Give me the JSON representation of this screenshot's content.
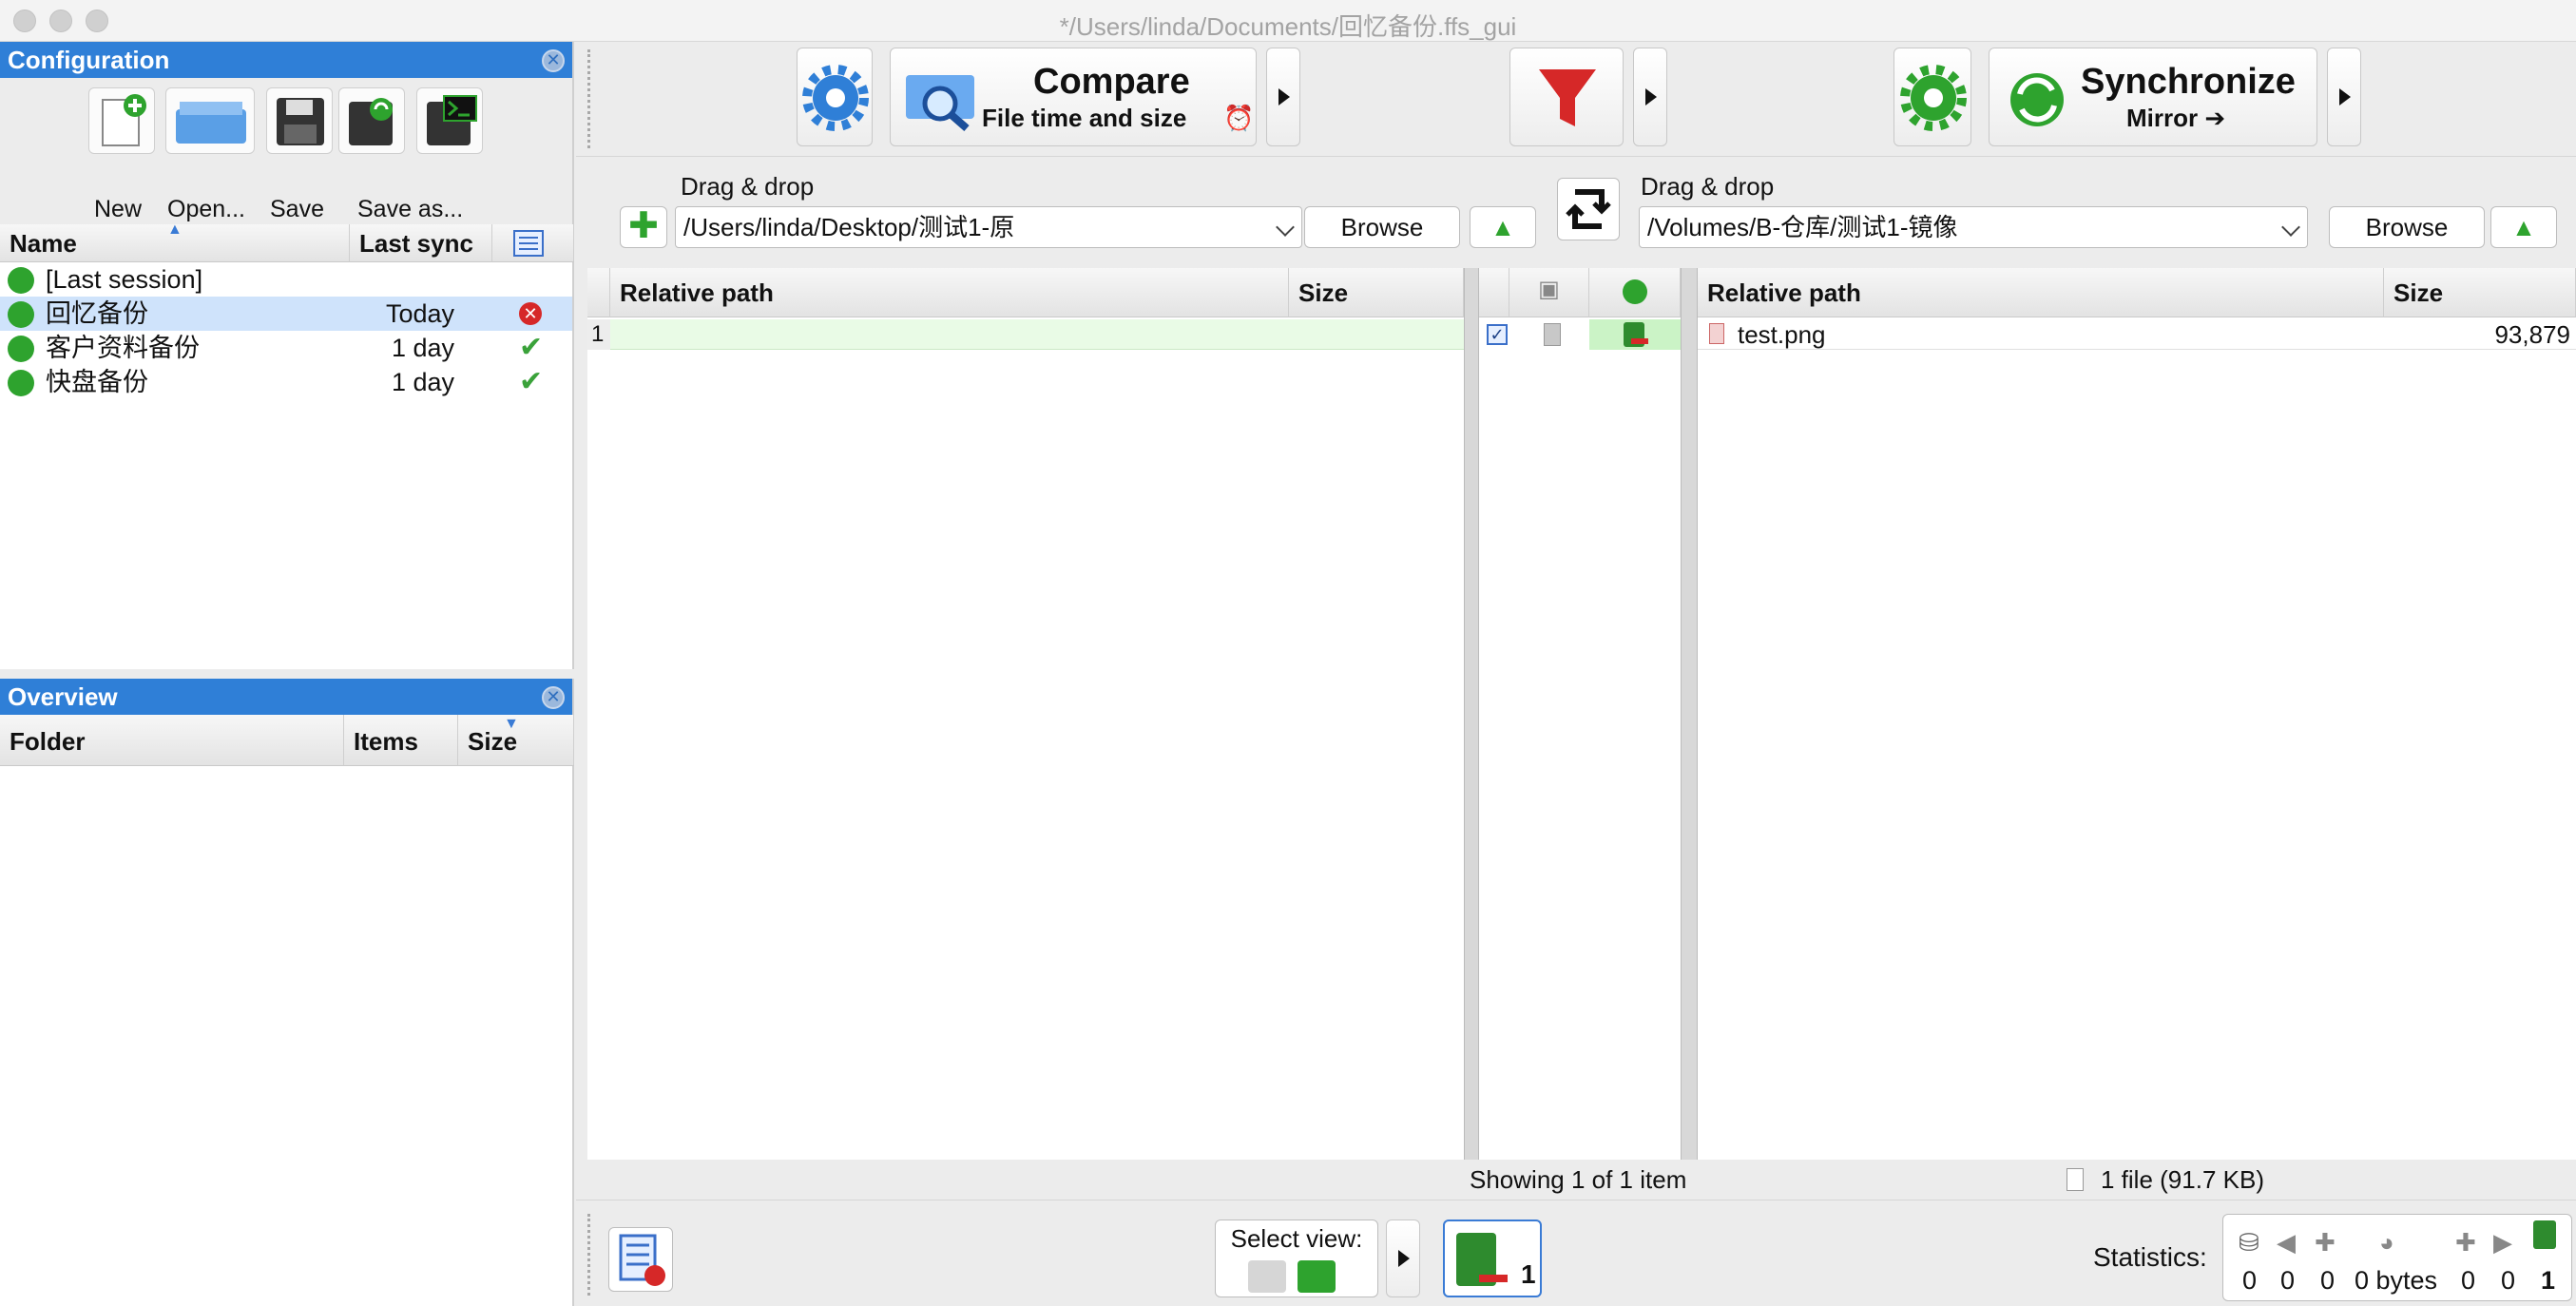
{
  "window": {
    "title": "*/Users/linda/Documents/回忆备份.ffs_gui"
  },
  "configuration": {
    "title": "Configuration",
    "toolbar": {
      "new": "New",
      "open": "Open...",
      "save": "Save",
      "save_as": "Save as..."
    },
    "columns": {
      "name": "Name",
      "last_sync": "Last sync"
    },
    "items": [
      {
        "name": "[Last session]",
        "last_sync": "",
        "status": ""
      },
      {
        "name": "回忆备份",
        "last_sync": "Today",
        "status": "error"
      },
      {
        "name": "客户资料备份",
        "last_sync": "1 day",
        "status": "ok"
      },
      {
        "name": "快盘备份",
        "last_sync": "1 day",
        "status": "ok"
      }
    ]
  },
  "overview": {
    "title": "Overview",
    "columns": {
      "folder": "Folder",
      "items": "Items",
      "size": "Size"
    }
  },
  "main_toolbar": {
    "compare": {
      "label": "Compare",
      "sublabel": "File time and size"
    },
    "synchronize": {
      "label": "Synchronize",
      "sublabel": "Mirror ➔"
    }
  },
  "left_folder": {
    "drag_label": "Drag & drop",
    "path": "/Users/linda/Desktop/测试1-原",
    "browse": "Browse"
  },
  "right_folder": {
    "drag_label": "Drag & drop",
    "path": "/Volumes/B-仓库/测试1-镜像",
    "browse": "Browse"
  },
  "grid": {
    "left_columns": {
      "relative_path": "Relative path",
      "size": "Size"
    },
    "right_columns": {
      "relative_path": "Relative path",
      "size": "Size"
    },
    "rows": [
      {
        "index": "1",
        "left_path": "",
        "left_size": "",
        "checked": true,
        "right_path": "test.png",
        "right_size": "93,879"
      }
    ]
  },
  "status": {
    "showing": "Showing 1 of 1 item",
    "right_summary": "1 file  (91.7 KB)"
  },
  "bottom": {
    "select_view": "Select view:",
    "delete_count": "1",
    "statistics_label": "Statistics:",
    "stats": [
      "0",
      "0",
      "0",
      "0 bytes",
      "0",
      "0",
      "1"
    ]
  },
  "colors": {
    "accent": "#2f7fd7",
    "selection": "#cfe3fb",
    "row_green": "#e9fbe6",
    "action_green": "#cbf3c6"
  }
}
